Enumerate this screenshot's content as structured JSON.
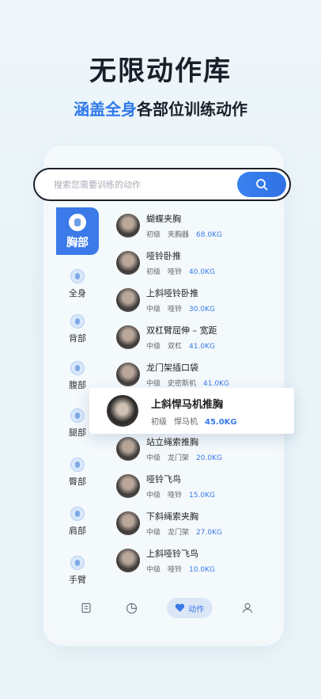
{
  "headline": "无限动作库",
  "subline": {
    "accent": "涵盖全身",
    "rest": "各部位训练动作"
  },
  "search": {
    "placeholder": "搜索您需要训练的动作"
  },
  "categories": [
    {
      "label": "胸部",
      "active": true
    },
    {
      "label": "全身"
    },
    {
      "label": "背部"
    },
    {
      "label": "腹部"
    },
    {
      "label": "腿部"
    },
    {
      "label": "臀部"
    },
    {
      "label": "肩部"
    },
    {
      "label": "手臂"
    }
  ],
  "exercises": [
    {
      "name": "蝴蝶夹胸",
      "level": "初级",
      "equipment": "夹胸器",
      "weight": "68.0KG"
    },
    {
      "name": "哑铃卧推",
      "level": "初级",
      "equipment": "哑铃",
      "weight": "40.0KG"
    },
    {
      "name": "上斜哑铃卧推",
      "level": "中级",
      "equipment": "哑铃",
      "weight": "30.0KG"
    },
    {
      "name": "双杠臂屈伸 – 宽距",
      "level": "中级",
      "equipment": "双杠",
      "weight": "41.0KG"
    },
    {
      "name": "龙门架插口袋",
      "level": "中级",
      "equipment": "史密斯机",
      "weight": "41.0KG"
    },
    {
      "name": "站立绳索推胸",
      "level": "中级",
      "equipment": "龙门架",
      "weight": "20.0KG"
    },
    {
      "name": "哑铃飞鸟",
      "level": "中级",
      "equipment": "哑铃",
      "weight": "15.0KG"
    },
    {
      "name": "下斜绳索夹胸",
      "level": "中级",
      "equipment": "龙门架",
      "weight": "27.0KG"
    },
    {
      "name": "上斜哑铃飞鸟",
      "level": "中级",
      "equipment": "哑铃",
      "weight": "10.0KG"
    }
  ],
  "highlight": {
    "name": "上斜悍马机推胸",
    "level": "初级",
    "equipment": "悍马机",
    "weight": "45.0KG"
  },
  "tabbar": {
    "active_label": "动作",
    "icons": [
      "document-icon",
      "chart-icon",
      "heart-icon",
      "user-icon"
    ]
  },
  "colors": {
    "accent": "#3b7ae8",
    "dark": "#1b1f2a"
  }
}
